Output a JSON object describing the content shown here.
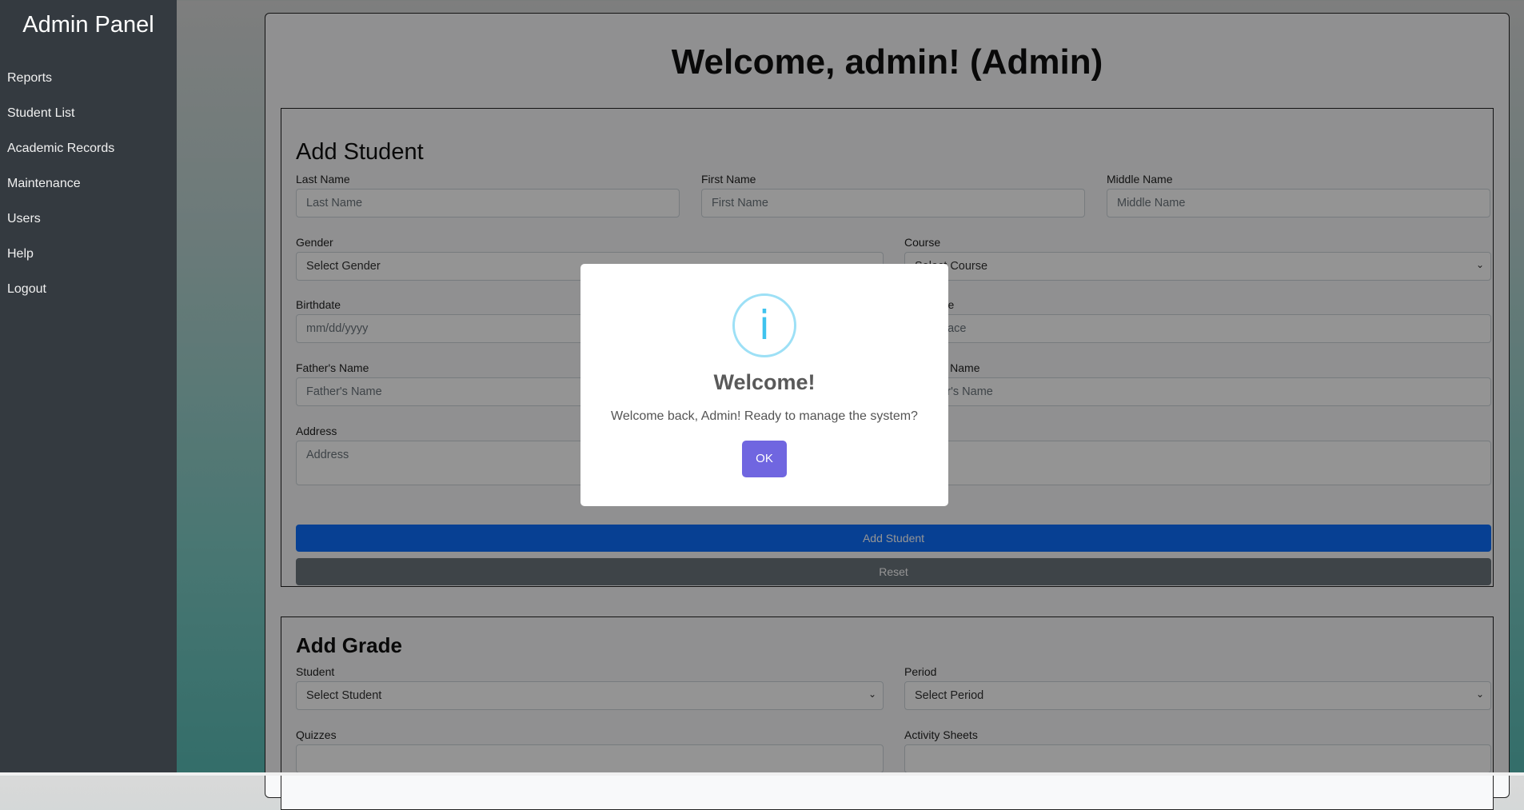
{
  "sidebar": {
    "brand": "Admin Panel",
    "items": [
      "Reports",
      "Student List",
      "Academic Records",
      "Maintenance",
      "Users",
      "Help",
      "Logout"
    ]
  },
  "main": {
    "welcome": "Welcome, admin! (Admin)"
  },
  "add_student": {
    "title": "Add Student",
    "last_name": {
      "label": "Last Name",
      "placeholder": "Last Name"
    },
    "first_name": {
      "label": "First Name",
      "placeholder": "First Name"
    },
    "middle_name": {
      "label": "Middle Name",
      "placeholder": "Middle Name"
    },
    "gender": {
      "label": "Gender",
      "value": "Select Gender"
    },
    "course": {
      "label": "Course",
      "value": "Select Course"
    },
    "birthdate": {
      "label": "Birthdate",
      "placeholder": "mm/dd/yyyy"
    },
    "birthplace": {
      "label": "Birthplace",
      "placeholder": "Birthplace"
    },
    "father": {
      "label": "Father's Name",
      "placeholder": "Father's Name"
    },
    "mother": {
      "label": "Mother's Name",
      "placeholder": "Mother's Name"
    },
    "address": {
      "label": "Address",
      "placeholder": "Address"
    },
    "add_button": "Add Student",
    "reset_button": "Reset"
  },
  "add_grade": {
    "title": "Add Grade",
    "student": {
      "label": "Student",
      "value": "Select Student"
    },
    "period": {
      "label": "Period",
      "value": "Select Period"
    },
    "quizzes": {
      "label": "Quizzes"
    },
    "activity": {
      "label": "Activity Sheets"
    }
  },
  "modal": {
    "icon": "info-icon",
    "title": "Welcome!",
    "message": "Welcome back, Admin! Ready to manage the system?",
    "ok": "OK"
  }
}
